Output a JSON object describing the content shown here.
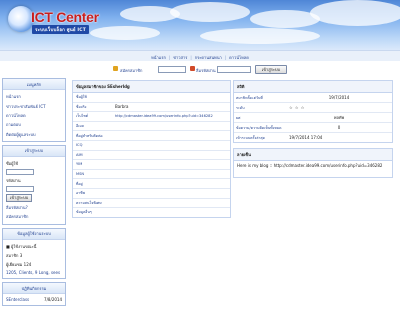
{
  "header": {
    "logo_title": "ICT Center",
    "logo_subtitle": "ระบบเว็บบล็อก ศูนย์ ICT"
  },
  "nav": {
    "items": [
      "หน้าแรก",
      "ข่าวสาร",
      "กระดานสนทนา",
      "ดาวน์โหลด"
    ]
  },
  "toolbar": {
    "link1": "สมัครสมาชิก",
    "link2": "ลืมรหัสผ่าน",
    "login_button": "เข้าสู่ระบบ"
  },
  "sidebar": {
    "menu": {
      "title": "เมนูหลัก",
      "items": [
        "หน้าแรก",
        "ข่าวประชาสัมพันธ์ ICT",
        "ดาวน์โหลด",
        "ถามตอบ",
        "ติดต่อผู้ดูแลระบบ"
      ]
    },
    "login": {
      "title": "เข้าสู่ระบบ",
      "user_label": "ชื่อผู้ใช้",
      "pass_label": "รหัสผ่าน",
      "button": "เข้าสู่ระบบ",
      "link1": "ลืมรหัสผ่าน?",
      "link2": "สมัครสมาชิก"
    },
    "stats": {
      "title": "ข้อมูลผู้ใช้งานระบบ",
      "line1": "■ ผู้ใช้งานขณะนี้",
      "line2": "สมาชิก 3",
      "line3": "ผู้เยี่ยมชม 124",
      "line4": "1205, Clients, 9 Long, sees"
    },
    "calendar": {
      "title": "ปฏิทินกิจกรรม",
      "name": "SEnterclass",
      "date": "7/8/2014"
    }
  },
  "profile": {
    "title": "ข้อมูลสมาชิกของ SEsherldg",
    "rows": [
      {
        "label": "ชื่อผู้ใช้",
        "value": ""
      },
      {
        "label": "ชื่อจริง",
        "value": "Barbra"
      },
      {
        "label": "เว็บไซต์",
        "value": "http://cdmaster.idea99.com/userinfo.php?uid=346282"
      },
      {
        "label": "อีเมล",
        "value": ""
      },
      {
        "label": "ที่อยู่สำหรับติดต่อ",
        "value": ""
      },
      {
        "label": "ICQ",
        "value": ""
      },
      {
        "label": "AIM",
        "value": ""
      },
      {
        "label": "YIM",
        "value": ""
      },
      {
        "label": "MSN",
        "value": ""
      },
      {
        "label": "ที่อยู่",
        "value": ""
      },
      {
        "label": "อาชีพ",
        "value": ""
      },
      {
        "label": "ความสนใจพิเศษ",
        "value": ""
      },
      {
        "label": "ข้อมูลอื่นๆ",
        "value": ""
      }
    ]
  },
  "stats_box": {
    "title": "สถิติ",
    "rows": [
      {
        "label": "สมาชิกตั้งแต่วันที่",
        "value": "19/7/2014"
      },
      {
        "label": "ระดับ",
        "value": ""
      },
      {
        "label": "ยศ",
        "value": "พลทัพ"
      },
      {
        "label": "ข้อความ/ความคิดเห็นทั้งหมด",
        "value": "0"
      },
      {
        "label": "เข้าระบบครั้งล่าสุด",
        "value": "19/7/2014 17:04"
      }
    ]
  },
  "signature": {
    "title": "ลายเซ็น",
    "text": "Here is my blog :: http://cdmaster.idea99.com/userinfo.php?uid=346282"
  }
}
